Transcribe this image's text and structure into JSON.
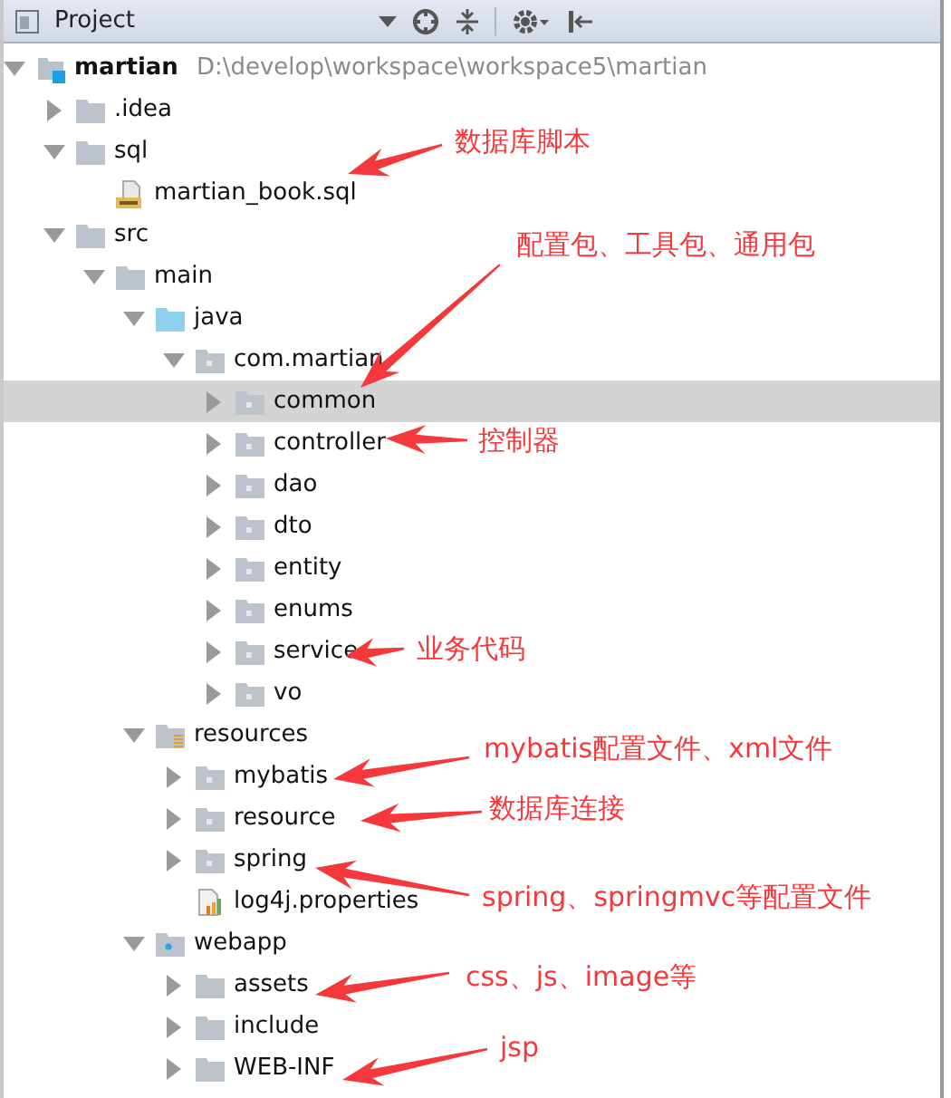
{
  "panel": {
    "title": "Project"
  },
  "tree": [
    {
      "name": "martian",
      "path": "D:\\develop\\workspace\\workspace5\\martian",
      "kind": "module",
      "expanded": true,
      "selected": false,
      "children": [
        {
          "name": ".idea",
          "kind": "folder",
          "expanded": false,
          "selected": false
        },
        {
          "name": "sql",
          "kind": "folder",
          "expanded": true,
          "selected": false,
          "children": [
            {
              "name": "martian_book.sql",
              "kind": "sql-file",
              "selected": false
            }
          ]
        },
        {
          "name": "src",
          "kind": "folder",
          "expanded": true,
          "selected": false,
          "children": [
            {
              "name": "main",
              "kind": "folder",
              "expanded": true,
              "selected": false,
              "children": [
                {
                  "name": "java",
                  "kind": "source-folder",
                  "expanded": true,
                  "selected": false,
                  "children": [
                    {
                      "name": "com.martian",
                      "kind": "package",
                      "expanded": true,
                      "selected": false,
                      "children": [
                        {
                          "name": "common",
                          "kind": "package",
                          "expanded": false,
                          "selected": true
                        },
                        {
                          "name": "controller",
                          "kind": "package",
                          "expanded": false,
                          "selected": false
                        },
                        {
                          "name": "dao",
                          "kind": "package",
                          "expanded": false,
                          "selected": false
                        },
                        {
                          "name": "dto",
                          "kind": "package",
                          "expanded": false,
                          "selected": false
                        },
                        {
                          "name": "entity",
                          "kind": "package",
                          "expanded": false,
                          "selected": false
                        },
                        {
                          "name": "enums",
                          "kind": "package",
                          "expanded": false,
                          "selected": false
                        },
                        {
                          "name": "service",
                          "kind": "package",
                          "expanded": false,
                          "selected": false
                        },
                        {
                          "name": "vo",
                          "kind": "package",
                          "expanded": false,
                          "selected": false
                        }
                      ]
                    }
                  ]
                },
                {
                  "name": "resources",
                  "kind": "resource-folder",
                  "expanded": true,
                  "selected": false,
                  "children": [
                    {
                      "name": "mybatis",
                      "kind": "package",
                      "expanded": false,
                      "selected": false
                    },
                    {
                      "name": "resource",
                      "kind": "package",
                      "expanded": false,
                      "selected": false
                    },
                    {
                      "name": "spring",
                      "kind": "package",
                      "expanded": false,
                      "selected": false
                    },
                    {
                      "name": "log4j.properties",
                      "kind": "properties-file",
                      "selected": false
                    }
                  ]
                },
                {
                  "name": "webapp",
                  "kind": "web-folder",
                  "expanded": true,
                  "selected": false,
                  "children": [
                    {
                      "name": "assets",
                      "kind": "folder",
                      "expanded": false,
                      "selected": false
                    },
                    {
                      "name": "include",
                      "kind": "folder",
                      "expanded": false,
                      "selected": false
                    },
                    {
                      "name": "WEB-INF",
                      "kind": "folder",
                      "expanded": false,
                      "selected": false
                    }
                  ]
                }
              ]
            }
          ]
        }
      ]
    }
  ],
  "annotations": [
    {
      "text": "数据库脚本"
    },
    {
      "text": "配置包、工具包、通用包"
    },
    {
      "text": "控制器"
    },
    {
      "text": "业务代码"
    },
    {
      "text": "mybatis配置文件、xml文件"
    },
    {
      "text": "数据库连接"
    },
    {
      "text": "spring、springmvc等配置文件"
    },
    {
      "text": "css、js、image等"
    },
    {
      "text": "jsp"
    }
  ]
}
